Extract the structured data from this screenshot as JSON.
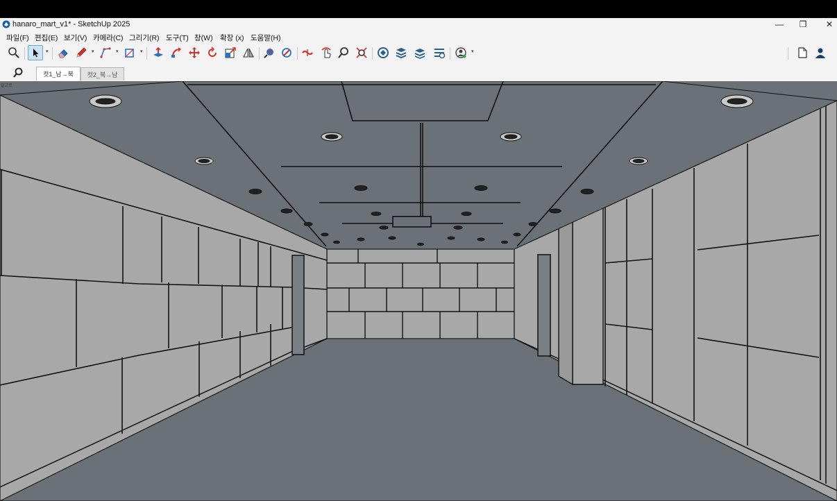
{
  "window": {
    "title": "hanaro_mart_v1* - SketchUp 2025",
    "controls": {
      "minimize": "—",
      "restore": "❐",
      "close": "✕"
    }
  },
  "menu": [
    "파일(F)",
    "편집(E)",
    "보기(V)",
    "카메라(C)",
    "그리기(R)",
    "도구(T)",
    "창(W)",
    "확장 (x)",
    "도움말(H)"
  ],
  "toolbar": {
    "tools": [
      "zoom-icon",
      "select-icon",
      "eraser-icon",
      "pencil-icon",
      "line-icon",
      "shape-icon",
      "push-pull-icon",
      "follow-me-icon",
      "move-icon",
      "rotate-icon",
      "scale-icon",
      "flip-icon",
      "paint-icon",
      "position-camera-icon",
      "walk-icon",
      "look-around-icon",
      "orbit-icon",
      "zoom-window-icon",
      "zoom-extents-icon",
      "warehouse-icon",
      "components-icon",
      "layers-icon",
      "extension-icon",
      "account-icon",
      "new-file-icon",
      "user-icon"
    ]
  },
  "scenes": {
    "search_icon": "search-icon",
    "tabs": [
      {
        "label": "컷1_남→북",
        "active": true
      },
      {
        "label": "컷2_북→남",
        "active": false
      }
    ]
  },
  "viewport": {
    "label": "알고르",
    "colors": {
      "ceiling": "#6b7177",
      "floor": "#6b7177",
      "wall": "#a8a8a8",
      "edge": "#111111"
    }
  }
}
